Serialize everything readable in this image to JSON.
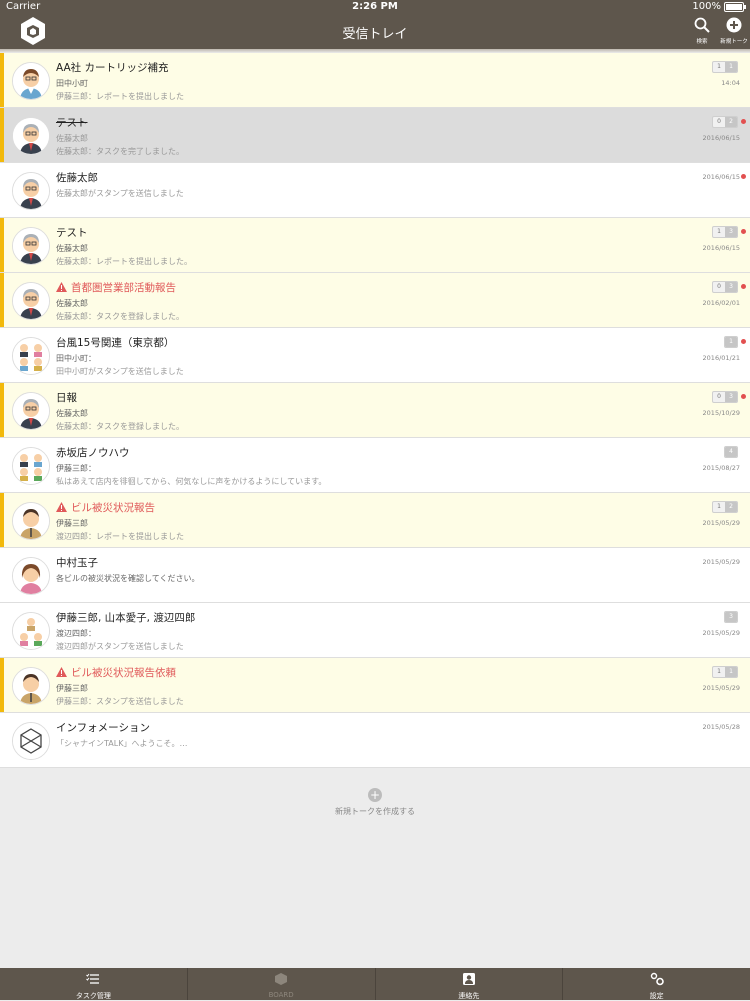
{
  "status_bar": {
    "carrier": "Carrier",
    "time": "2:26 PM",
    "battery": "100%"
  },
  "nav": {
    "title": "受信トレイ",
    "search_label": "検索",
    "new_talk_label": "新規トーク"
  },
  "rows": [
    {
      "name": "AA社 カートリッジ補充",
      "line2": "田中小町",
      "line3": "伊藤三郎：レポートを提出しました",
      "count_a": "1",
      "count_b": "1",
      "date": "14:04"
    },
    {
      "name": "テスト",
      "line2": "佐藤太郎",
      "line3": "佐藤太郎：タスクを完了しました。",
      "count_a": "0",
      "count_b": "2",
      "date": "2016/06/15"
    },
    {
      "name": "佐藤太郎",
      "line2": "佐藤太郎がスタンプを送信しました",
      "date": "2016/06/15"
    },
    {
      "name": "テスト",
      "line2": "佐藤太郎",
      "line3": "佐藤太郎：レポートを提出しました。",
      "count_a": "1",
      "count_b": "3",
      "date": "2016/06/15"
    },
    {
      "name": "首都圏営業部活動報告",
      "line2": "佐藤太郎",
      "line3": "佐藤太郎：タスクを登録しました。",
      "count_a": "0",
      "count_b": "3",
      "date": "2016/02/01"
    },
    {
      "name": "台風15号関連（東京都）",
      "line2": "田中小町：",
      "line3": "田中小町がスタンプを送信しました",
      "count_a": "1",
      "date": "2016/01/21"
    },
    {
      "name": "日報",
      "line2": "佐藤太郎",
      "line3": "佐藤太郎：タスクを登録しました。",
      "count_a": "0",
      "count_b": "3",
      "date": "2015/10/29"
    },
    {
      "name": "赤坂店ノウハウ",
      "line2": "伊藤三郎：",
      "line3": "私はあえて店内を徘徊してから、何気なしに声をかけるようにしています。",
      "count_a": "4",
      "date": "2015/08/27"
    },
    {
      "name": "ビル被災状況報告",
      "line2": "伊藤三郎",
      "line3": "渡辺四郎：レポートを提出しました",
      "count_a": "1",
      "count_b": "2",
      "date": "2015/05/29"
    },
    {
      "name": "中村玉子",
      "line2": "各ビルの被災状況を確認してください。",
      "date": "2015/05/29"
    },
    {
      "name": "伊藤三郎, 山本愛子, 渡辺四郎",
      "line2": "渡辺四郎：",
      "line3": "渡辺四郎がスタンプを送信しました",
      "count_a": "3",
      "date": "2015/05/29"
    },
    {
      "name": "ビル被災状況報告依頼",
      "line2": "伊藤三郎",
      "line3": "伊藤三郎：スタンプを送信しました",
      "count_a": "1",
      "count_b": "1",
      "date": "2015/05/29"
    },
    {
      "name": "インフォメーション",
      "line2": "「シャナインTALK」へようこそ。…",
      "date": "2015/05/28"
    }
  ],
  "new_talk_button": "新規トークを作成する",
  "tabs": [
    {
      "label": "タスク管理"
    },
    {
      "label": "BOARD"
    },
    {
      "label": "連絡先"
    },
    {
      "label": "設定"
    }
  ],
  "colors": {
    "header": "#5e564c",
    "accent_bar": "#f2b90c",
    "unread_bg": "#fefde6",
    "alert": "#e05a5a"
  }
}
